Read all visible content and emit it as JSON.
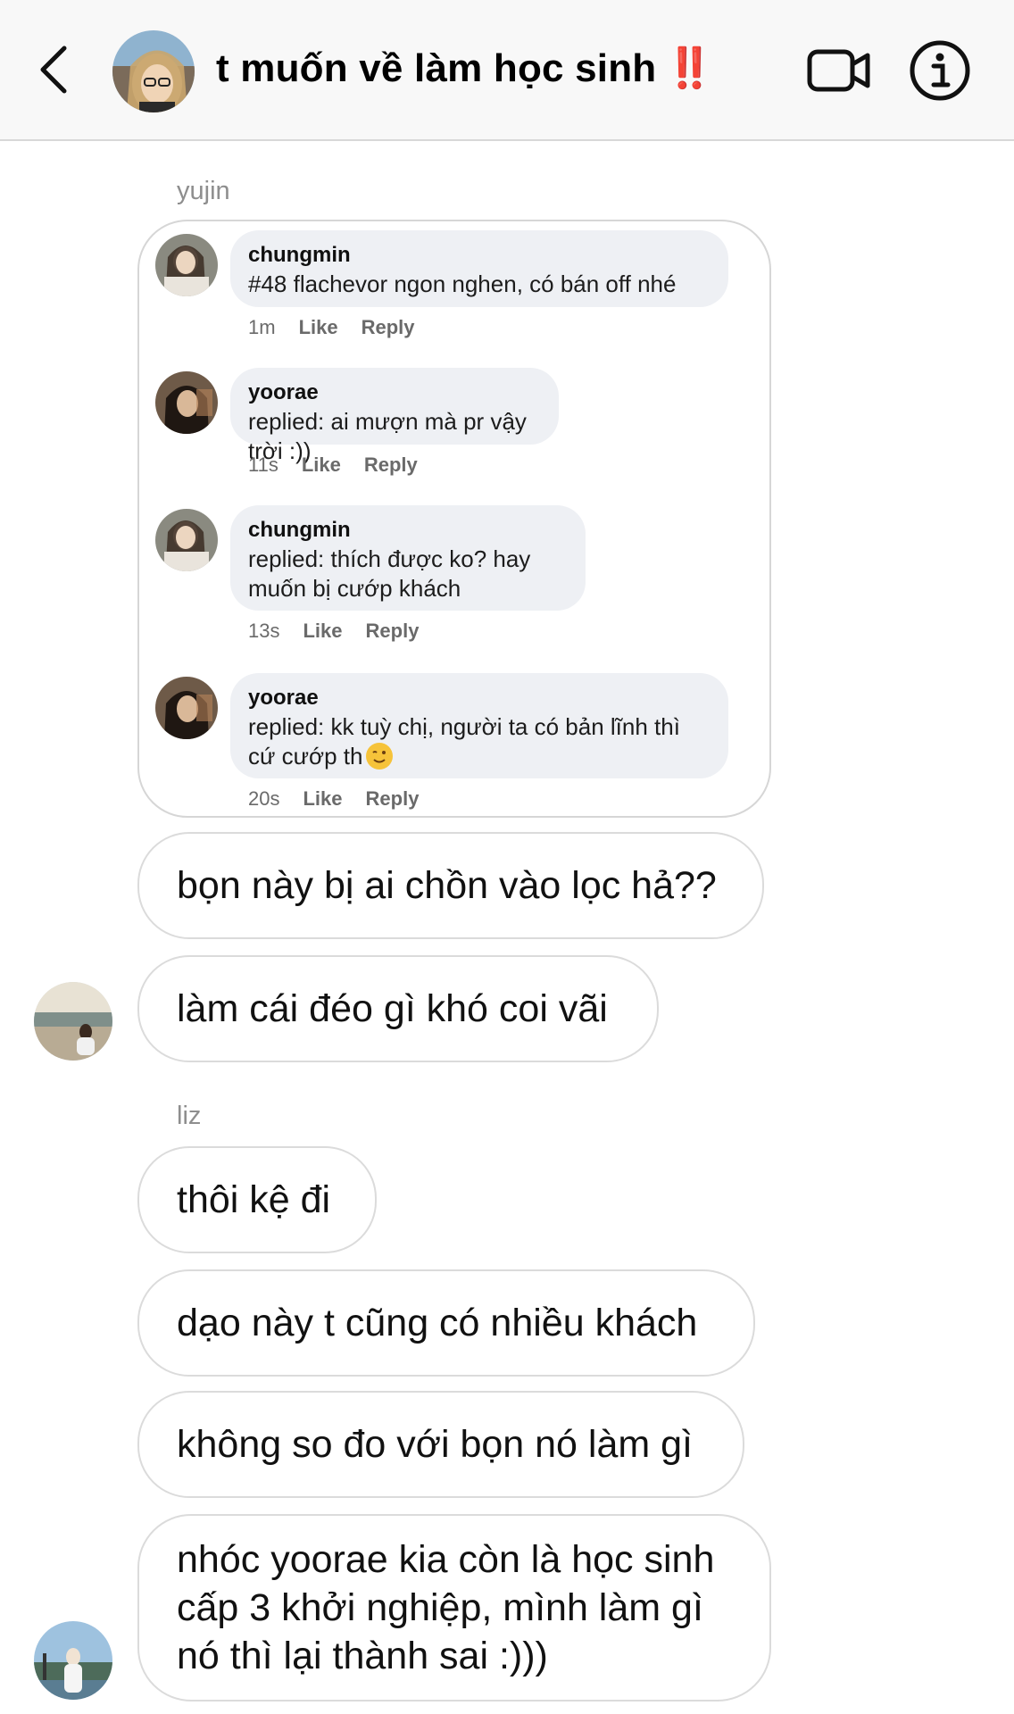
{
  "header": {
    "title": "t muốn về làm học sinh",
    "title_marks": "‼️",
    "icons": {
      "back": "chevron-left-icon",
      "video": "video-call-icon",
      "info": "info-icon"
    }
  },
  "messages": {
    "group1_sender": "yujin",
    "shared_card": {
      "comments": [
        {
          "name": "chungmin",
          "text": "#48 flachevor ngon nghen, có bán off nhé",
          "time": "1m",
          "like": "Like",
          "reply": "Reply"
        },
        {
          "name": "yoorae",
          "text": "replied: ai mượn mà pr vậy trời :))",
          "time": "11s",
          "like": "Like",
          "reply": "Reply"
        },
        {
          "name": "chungmin",
          "text": "replied: thích được ko? hay muốn bị cướp khách",
          "time": "13s",
          "like": "Like",
          "reply": "Reply"
        },
        {
          "name": "yoorae",
          "text": "replied: kk tuỳ chị, người ta có bản lĩnh thì cứ cướp th",
          "emoji": "winking-face",
          "time": "20s",
          "like": "Like",
          "reply": "Reply"
        }
      ]
    },
    "m1": "bọn này bị ai chồn vào lọc hả??",
    "m2": "làm cái đéo gì khó coi vãi",
    "group2_sender": "liz",
    "m3": "thôi kệ đi",
    "m4": "dạo này t cũng có nhiều khách",
    "m5": "không so đo với bọn nó làm gì",
    "m6": "nhóc yoorae kia còn là học sinh cấp 3 khởi nghiệp, mình làm gì nó thì lại thành sai :)))"
  }
}
